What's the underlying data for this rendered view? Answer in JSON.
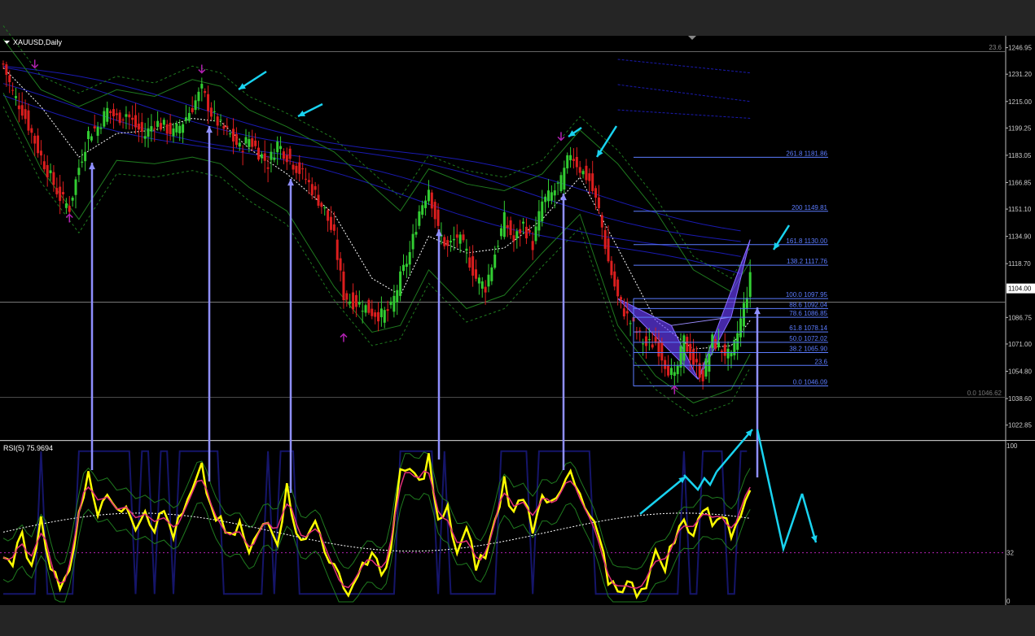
{
  "symbol_label": "XAUUSD,Daily",
  "rsi_label": "RSI(5) 75.9694",
  "colors": {
    "bg": "#000000",
    "frame": "#252525",
    "up_candle": "#32cd32",
    "down_candle": "#dc1e1e",
    "bands_blue": "#1a1ab0",
    "bands_green": "#1f7a1f",
    "fib": "#5c7cff",
    "pattern": "#6a3dff",
    "annot": "#19d3f0",
    "rsi_yellow": "#ffff00",
    "rsi_pink": "#e3307a",
    "marker": "#b020b0"
  },
  "chart_data": [
    {
      "type": "candlestick",
      "title": "XAUUSD,Daily",
      "ylim": [
        1014.0,
        1254.0
      ],
      "price_axis_ticks": [
        "1246.95",
        "1231.20",
        "1215.00",
        "1199.25",
        "1183.05",
        "1166.85",
        "1151.10",
        "1134.90",
        "1118.70",
        "1104.00",
        "1086.75",
        "1071.00",
        "1054.80",
        "1038.60",
        "1022.85"
      ],
      "current_price": "1104.00",
      "top_label": "23.6",
      "zero_label": "0.0 1046.62",
      "fib_levels": [
        {
          "label": "261.8 1181.86",
          "price": 1181.86
        },
        {
          "label": "200 1149.81",
          "price": 1149.81
        },
        {
          "label": "161.8 1130.00",
          "price": 1130.0
        },
        {
          "label": "138.2 1117.76",
          "price": 1117.76
        },
        {
          "label": "100.0 1097.95",
          "price": 1097.95
        },
        {
          "label": "88.6 1092.04",
          "price": 1092.04
        },
        {
          "label": "78.6 1086.85",
          "price": 1086.85
        },
        {
          "label": "61.8 1078.14",
          "price": 1078.14
        },
        {
          "label": "50.0 1072.02",
          "price": 1072.02
        },
        {
          "label": "38.2 1065.90",
          "price": 1065.9
        },
        {
          "label": "23.6",
          "price": 1058.3
        },
        {
          "label": "0.0 1046.09",
          "price": 1046.09
        }
      ],
      "close_path": [
        [
          0,
          1237
        ],
        [
          6,
          1220
        ],
        [
          12,
          1210
        ],
        [
          18,
          1196
        ],
        [
          24,
          1182
        ],
        [
          30,
          1170
        ],
        [
          36,
          1158
        ],
        [
          42,
          1152
        ],
        [
          48,
          1176
        ],
        [
          54,
          1196
        ],
        [
          60,
          1200
        ],
        [
          66,
          1210
        ],
        [
          72,
          1205
        ],
        [
          78,
          1208
        ],
        [
          84,
          1200
        ],
        [
          90,
          1195
        ],
        [
          96,
          1203
        ],
        [
          102,
          1200
        ],
        [
          108,
          1196
        ],
        [
          114,
          1203
        ],
        [
          120,
          1212
        ],
        [
          126,
          1222
        ],
        [
          132,
          1208
        ],
        [
          138,
          1200
        ],
        [
          144,
          1195
        ],
        [
          150,
          1187
        ],
        [
          156,
          1193
        ],
        [
          162,
          1185
        ],
        [
          168,
          1178
        ],
        [
          174,
          1190
        ],
        [
          180,
          1183
        ],
        [
          186,
          1176
        ],
        [
          192,
          1169
        ],
        [
          198,
          1160
        ],
        [
          204,
          1150
        ],
        [
          210,
          1134
        ],
        [
          216,
          1100
        ],
        [
          222,
          1096
        ],
        [
          228,
          1094
        ],
        [
          234,
          1090
        ],
        [
          240,
          1088
        ],
        [
          246,
          1092
        ],
        [
          252,
          1110
        ],
        [
          258,
          1125
        ],
        [
          264,
          1150
        ],
        [
          270,
          1164
        ],
        [
          276,
          1138
        ],
        [
          282,
          1128
        ],
        [
          288,
          1135
        ],
        [
          294,
          1125
        ],
        [
          300,
          1110
        ],
        [
          306,
          1105
        ],
        [
          312,
          1125
        ],
        [
          318,
          1145
        ],
        [
          324,
          1132
        ],
        [
          330,
          1142
        ],
        [
          336,
          1130
        ],
        [
          342,
          1155
        ],
        [
          348,
          1160
        ],
        [
          354,
          1167
        ],
        [
          360,
          1185
        ],
        [
          366,
          1175
        ],
        [
          372,
          1168
        ],
        [
          378,
          1150
        ],
        [
          384,
          1120
        ],
        [
          390,
          1098
        ],
        [
          396,
          1087
        ],
        [
          402,
          1078
        ],
        [
          408,
          1070
        ],
        [
          414,
          1072
        ],
        [
          420,
          1060
        ],
        [
          426,
          1050
        ],
        [
          432,
          1073
        ],
        [
          438,
          1060
        ],
        [
          444,
          1052
        ],
        [
          450,
          1073
        ],
        [
          456,
          1068
        ],
        [
          462,
          1062
        ],
        [
          468,
          1085
        ],
        [
          474,
          1110
        ]
      ],
      "upper_band": [
        [
          0,
          1252
        ],
        [
          24,
          1222
        ],
        [
          48,
          1212
        ],
        [
          72,
          1222
        ],
        [
          96,
          1218
        ],
        [
          120,
          1228
        ],
        [
          138,
          1224
        ],
        [
          156,
          1210
        ],
        [
          180,
          1200
        ],
        [
          210,
          1185
        ],
        [
          234,
          1165
        ],
        [
          252,
          1150
        ],
        [
          270,
          1175
        ],
        [
          294,
          1166
        ],
        [
          318,
          1162
        ],
        [
          342,
          1172
        ],
        [
          366,
          1198
        ],
        [
          390,
          1178
        ],
        [
          414,
          1150
        ],
        [
          438,
          1115
        ],
        [
          462,
          1102
        ],
        [
          474,
          1120
        ]
      ],
      "lower_band": [
        [
          0,
          1220
        ],
        [
          24,
          1175
        ],
        [
          48,
          1145
        ],
        [
          72,
          1180
        ],
        [
          96,
          1178
        ],
        [
          120,
          1182
        ],
        [
          138,
          1178
        ],
        [
          156,
          1164
        ],
        [
          180,
          1150
        ],
        [
          210,
          1105
        ],
        [
          234,
          1078
        ],
        [
          252,
          1082
        ],
        [
          270,
          1115
        ],
        [
          294,
          1092
        ],
        [
          318,
          1100
        ],
        [
          342,
          1125
        ],
        [
          366,
          1148
        ],
        [
          390,
          1082
        ],
        [
          414,
          1052
        ],
        [
          438,
          1036
        ],
        [
          462,
          1044
        ],
        [
          474,
          1065
        ]
      ],
      "mid_line": [
        [
          0,
          1235
        ],
        [
          24,
          1212
        ],
        [
          48,
          1182
        ],
        [
          72,
          1196
        ],
        [
          96,
          1198
        ],
        [
          120,
          1205
        ],
        [
          138,
          1203
        ],
        [
          156,
          1187
        ],
        [
          180,
          1172
        ],
        [
          210,
          1148
        ],
        [
          234,
          1110
        ],
        [
          252,
          1100
        ],
        [
          270,
          1135
        ],
        [
          294,
          1125
        ],
        [
          318,
          1128
        ],
        [
          342,
          1145
        ],
        [
          366,
          1170
        ],
        [
          390,
          1128
        ],
        [
          414,
          1085
        ],
        [
          438,
          1068
        ],
        [
          462,
          1070
        ],
        [
          474,
          1085
        ]
      ],
      "blue_envelopes": [
        {
          "start": 1236,
          "end": 1140
        },
        {
          "start": 1232,
          "end": 1130
        },
        {
          "start": 1222,
          "end": 1118
        },
        {
          "start": 1218,
          "end": 1108
        }
      ],
      "pattern_points": [
        {
          "i": 390,
          "price": 1098
        },
        {
          "i": 424,
          "price": 1082
        },
        {
          "i": 441,
          "price": 1050
        },
        {
          "i": 462,
          "price": 1087
        },
        {
          "i": 474,
          "price": 1133
        }
      ]
    },
    {
      "type": "line",
      "title": "RSI(5) 75.9694",
      "ylim": [
        0,
        100
      ],
      "axis_ticks": [
        "100",
        "32",
        "0"
      ],
      "reference_level": 32,
      "rsi": [
        [
          0,
          30
        ],
        [
          6,
          25
        ],
        [
          12,
          45
        ],
        [
          18,
          20
        ],
        [
          24,
          55
        ],
        [
          30,
          25
        ],
        [
          36,
          8
        ],
        [
          42,
          20
        ],
        [
          48,
          60
        ],
        [
          54,
          80
        ],
        [
          60,
          60
        ],
        [
          66,
          72
        ],
        [
          72,
          55
        ],
        [
          78,
          65
        ],
        [
          84,
          50
        ],
        [
          90,
          60
        ],
        [
          96,
          48
        ],
        [
          102,
          58
        ],
        [
          108,
          44
        ],
        [
          114,
          56
        ],
        [
          120,
          70
        ],
        [
          126,
          84
        ],
        [
          132,
          60
        ],
        [
          138,
          50
        ],
        [
          144,
          40
        ],
        [
          150,
          50
        ],
        [
          156,
          30
        ],
        [
          162,
          45
        ],
        [
          168,
          55
        ],
        [
          174,
          40
        ],
        [
          180,
          72
        ],
        [
          186,
          48
        ],
        [
          192,
          38
        ],
        [
          198,
          52
        ],
        [
          204,
          36
        ],
        [
          210,
          22
        ],
        [
          216,
          8
        ],
        [
          222,
          12
        ],
        [
          228,
          25
        ],
        [
          234,
          30
        ],
        [
          240,
          18
        ],
        [
          246,
          35
        ],
        [
          252,
          80
        ],
        [
          258,
          85
        ],
        [
          264,
          75
        ],
        [
          270,
          92
        ],
        [
          276,
          50
        ],
        [
          282,
          58
        ],
        [
          288,
          32
        ],
        [
          294,
          45
        ],
        [
          300,
          25
        ],
        [
          306,
          30
        ],
        [
          312,
          50
        ],
        [
          318,
          78
        ],
        [
          324,
          55
        ],
        [
          330,
          70
        ],
        [
          336,
          48
        ],
        [
          342,
          72
        ],
        [
          348,
          60
        ],
        [
          354,
          70
        ],
        [
          360,
          82
        ],
        [
          366,
          65
        ],
        [
          372,
          55
        ],
        [
          378,
          40
        ],
        [
          384,
          15
        ],
        [
          390,
          10
        ],
        [
          396,
          12
        ],
        [
          402,
          8
        ],
        [
          408,
          14
        ],
        [
          414,
          30
        ],
        [
          420,
          25
        ],
        [
          426,
          40
        ],
        [
          432,
          52
        ],
        [
          438,
          45
        ],
        [
          444,
          60
        ],
        [
          450,
          52
        ],
        [
          456,
          58
        ],
        [
          462,
          42
        ],
        [
          468,
          60
        ],
        [
          474,
          76
        ]
      ]
    }
  ]
}
